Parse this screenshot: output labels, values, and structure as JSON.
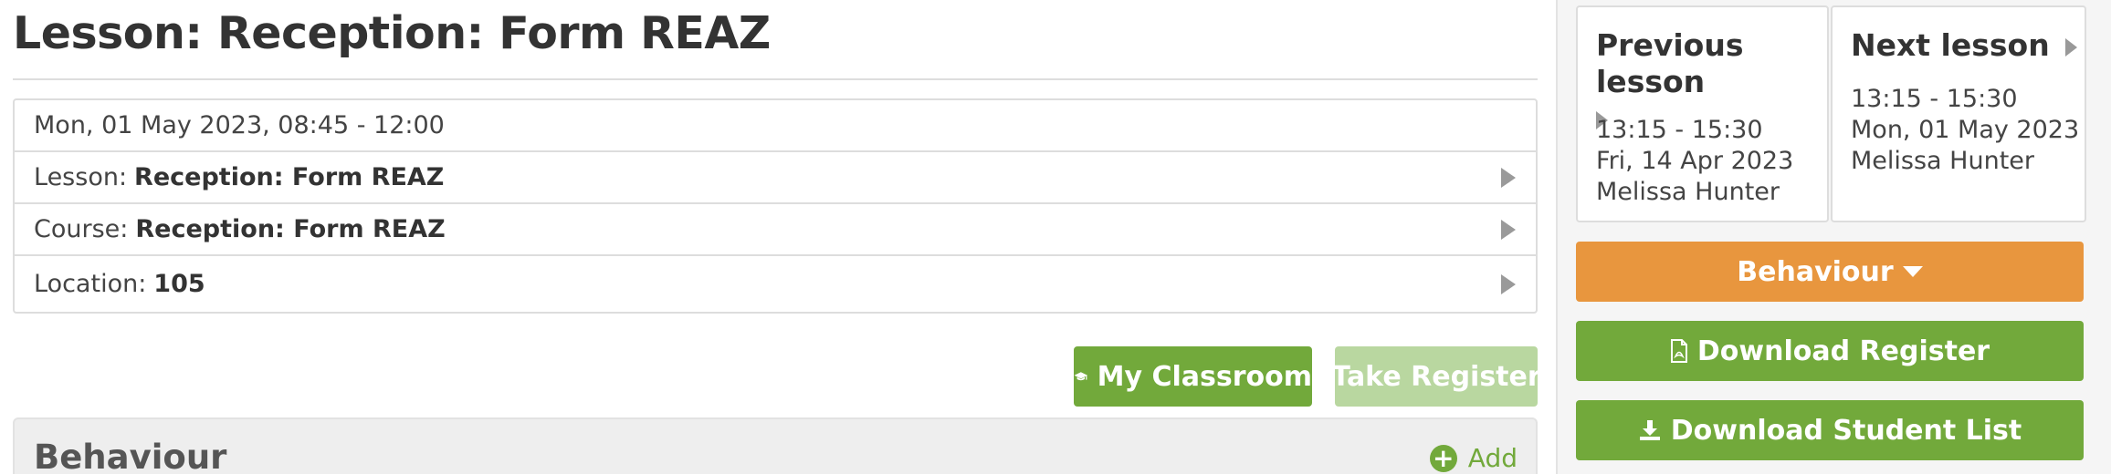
{
  "page_title": "Lesson: Reception: Form REAZ",
  "details": {
    "datetime": "Mon, 01 May 2023, 08:45 - 12:00",
    "lesson_label": "Lesson:",
    "lesson_value": "Reception: Form REAZ",
    "course_label": "Course:",
    "course_value": "Reception: Form REAZ",
    "location_label": "Location:",
    "location_value": "105"
  },
  "actions": {
    "my_classroom": "My Classroom",
    "take_register": "Take Register"
  },
  "behaviour_panel": {
    "title": "Behaviour",
    "add_label": "Add"
  },
  "sidebar": {
    "previous_lesson": {
      "title": "Previous lesson",
      "time": "13:15 - 15:30",
      "date": "Fri, 14 Apr 2023",
      "teacher": "Melissa Hunter"
    },
    "next_lesson": {
      "title": "Next lesson",
      "time": "13:15 - 15:30",
      "date": "Mon, 01 May 2023",
      "teacher": "Melissa Hunter"
    },
    "behaviour_button": "Behaviour",
    "download_register": "Download Register",
    "download_student_list": "Download Student List"
  },
  "icons": {
    "my_classroom": "graduation-cap-icon",
    "download_register": "pdf-file-icon",
    "download_student_list": "download-icon",
    "add": "plus-circle-icon",
    "behaviour_dropdown": "caret-down-icon",
    "row_arrow": "caret-right-icon"
  },
  "colors": {
    "green": "#72a93b",
    "green_disabled": "#b9d7a0",
    "orange": "#e8963e",
    "text": "#333333"
  }
}
